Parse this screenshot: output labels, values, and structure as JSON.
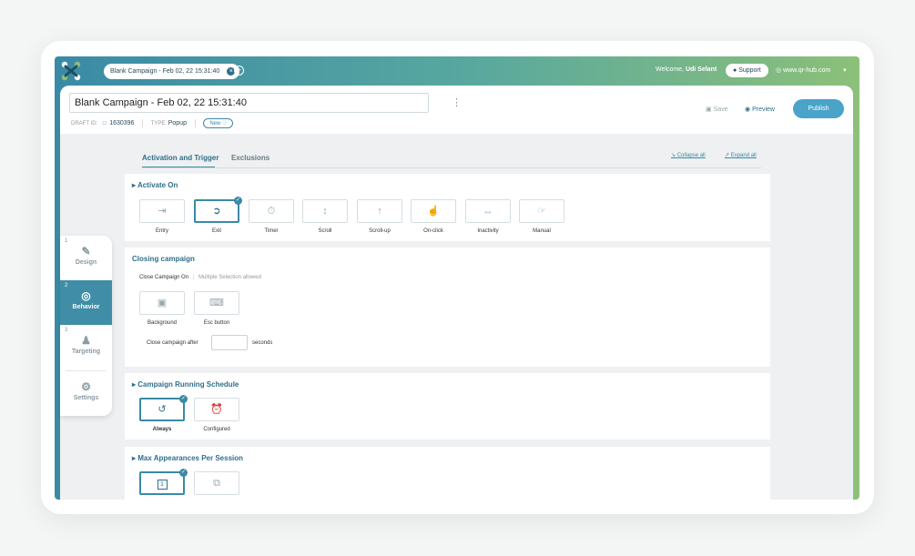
{
  "topbar": {
    "tab_title": "Blank Campaign - Feb 02, 22 15:31:40",
    "welcome_prefix": "Welcome,",
    "user_name": "Udi Selant",
    "support_label": "Support",
    "site_label": "www.qr-hub.com"
  },
  "header": {
    "campaign_name": "Blank Campaign - Feb 02, 22 15:31:40",
    "draft_id_label": "DRAFT ID:",
    "draft_id": "1630396",
    "type_label": "TYPE:",
    "type_value": "Popup",
    "status_badge": "New",
    "save_label": "Save",
    "preview_label": "Preview",
    "publish_label": "Publish"
  },
  "sidenav": {
    "items": [
      {
        "num": "1",
        "label": "Design",
        "icon": "design-icon"
      },
      {
        "num": "2",
        "label": "Behavior",
        "icon": "behavior-icon"
      },
      {
        "num": "3",
        "label": "Targeting",
        "icon": "targeting-icon"
      },
      {
        "num": "",
        "label": "Settings",
        "icon": "settings-icon"
      }
    ]
  },
  "tabs": {
    "active": "Activation and Trigger",
    "other": "Exclusions",
    "collapse_all": "Collapse all",
    "expand_all": "Expand all"
  },
  "activate_on": {
    "title": "Activate On",
    "options": [
      "Entry",
      "Exit",
      "Timer",
      "Scroll",
      "Scroll-up",
      "On-click",
      "Inactivity",
      "Manual"
    ],
    "selected": "Exit"
  },
  "closing": {
    "title": "Closing campaign",
    "close_on_label": "Close Campaign On",
    "hint": "Multiple Selection allowed",
    "options": [
      "Background",
      "Esc button"
    ],
    "after_label": "Close campaign after",
    "after_value": "",
    "after_unit": "seconds"
  },
  "schedule": {
    "title": "Campaign Running Schedule",
    "options": [
      "Always",
      "Configured"
    ],
    "selected": "Always"
  },
  "max_appearances": {
    "title": "Max Appearances Per Session",
    "selected_value": "1"
  },
  "colors": {
    "accent": "#3a8aa6",
    "publish": "#4aa3c8",
    "gradient_start": "#3a8aa6",
    "gradient_end": "#8cc079"
  }
}
